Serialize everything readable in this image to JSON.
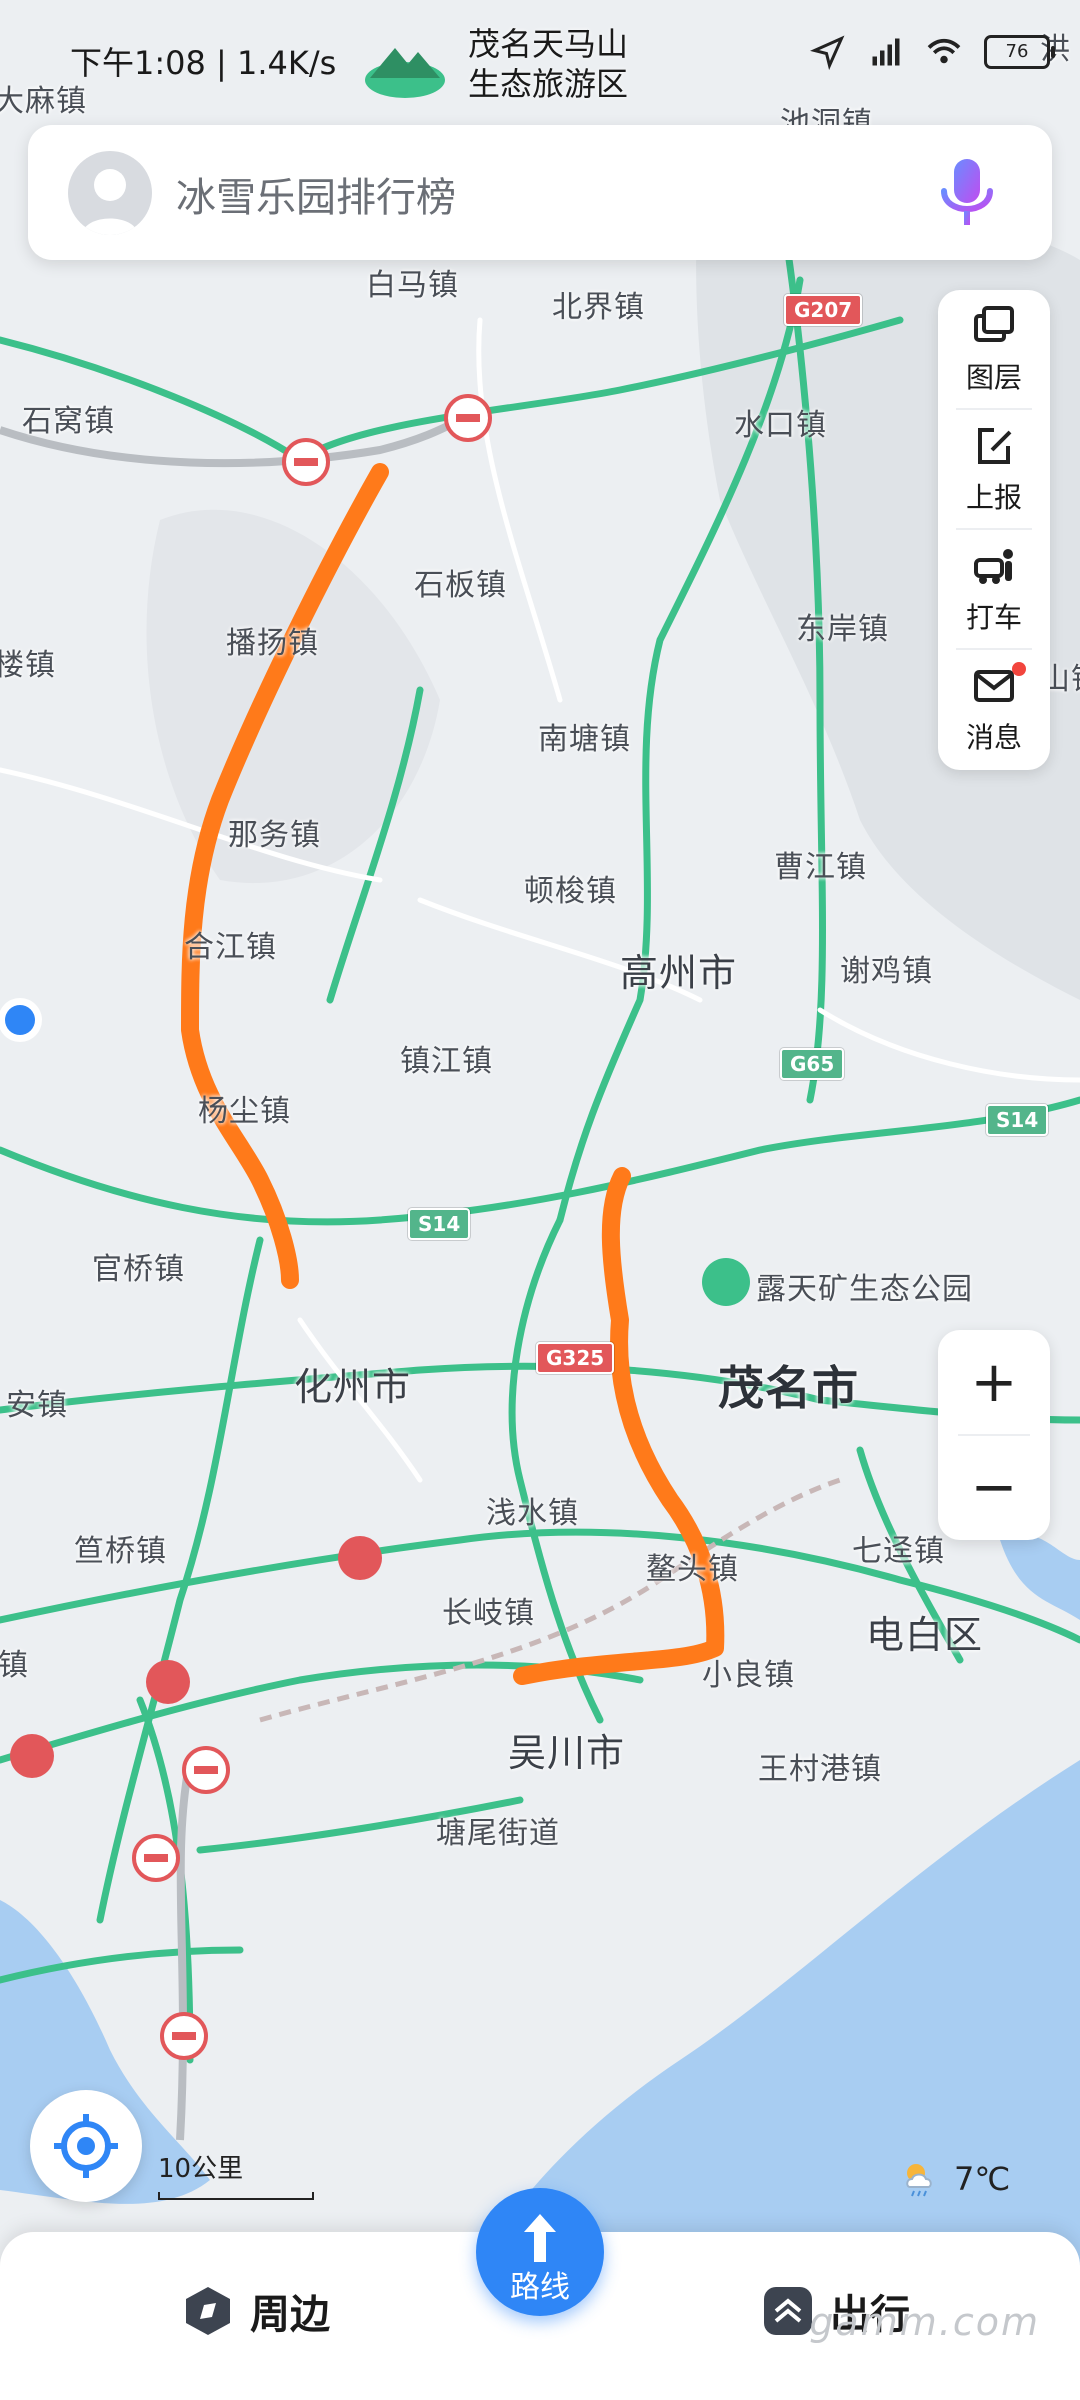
{
  "status_bar": {
    "time": "下午1:08 | 1.4K/s",
    "battery": "76",
    "scenic_spot": [
      "茂名天马山",
      "生态旅游区"
    ]
  },
  "search": {
    "placeholder": "冰雪乐园排行榜"
  },
  "toolbar": [
    {
      "label": "图层",
      "icon": "layers-icon"
    },
    {
      "label": "上报",
      "icon": "report-edit-icon"
    },
    {
      "label": "打车",
      "icon": "taxi-icon"
    },
    {
      "label": "消息",
      "icon": "message-icon",
      "badge": true
    }
  ],
  "zoom": {
    "in": "+",
    "out": "−"
  },
  "map": {
    "places": [
      "大麻镇",
      "白马镇",
      "北界镇",
      "池洞镇",
      "石窝镇",
      "水口镇",
      "石板镇",
      "播扬镇",
      "东岸镇",
      "楼镇",
      "南塘镇",
      "那务镇",
      "曹江镇",
      "顿梭镇",
      "合江镇",
      "高州市",
      "谢鸡镇",
      "镇江镇",
      "杨尘镇",
      "官桥镇",
      "露天矿生态公园",
      "化州市",
      "茂名市",
      "安镇",
      "浅水镇",
      "笪桥镇",
      "七迳镇",
      "长岐镇",
      "鳌头镇",
      "电白区",
      "镇",
      "小良镇",
      "吴川市",
      "王村港镇",
      "塘尾街道",
      "洪",
      "山镇"
    ],
    "shields": [
      "G207",
      "G65",
      "S14",
      "S14",
      "G325"
    ],
    "colors": {
      "road": "#3cc08a",
      "route": "#ff7a1a",
      "water": "#a8cdf2",
      "land": "#eceff2"
    }
  },
  "scale": "10公里",
  "weather": {
    "temp": "7℃",
    "icon": "cloudy-rain-icon"
  },
  "bottom_nav": {
    "nearby": "周边",
    "route": "路线",
    "travel": "出行"
  },
  "watermark": "gamm.com"
}
